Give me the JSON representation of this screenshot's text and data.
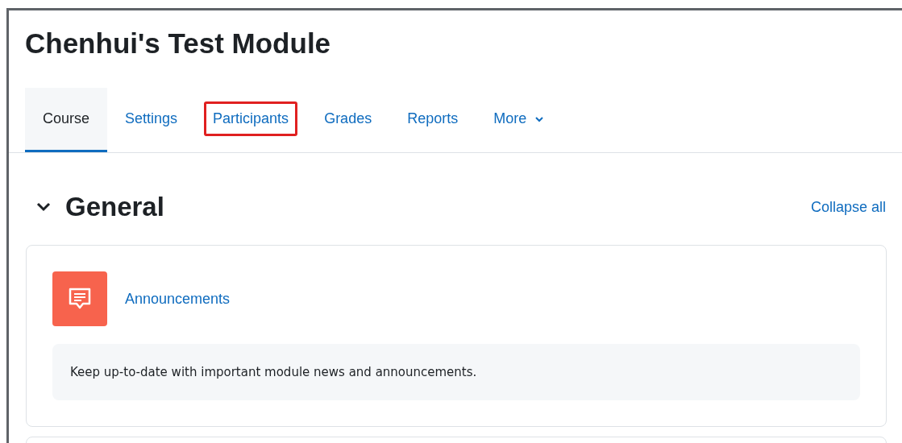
{
  "course_title": "Chenhui's Test Module",
  "tabs": [
    {
      "label": "Course",
      "selected": true,
      "highlighted": false,
      "kind": "plain"
    },
    {
      "label": "Settings",
      "selected": false,
      "highlighted": false,
      "kind": "plain"
    },
    {
      "label": "Participants",
      "selected": false,
      "highlighted": true,
      "kind": "plain"
    },
    {
      "label": "Grades",
      "selected": false,
      "highlighted": false,
      "kind": "plain"
    },
    {
      "label": "Reports",
      "selected": false,
      "highlighted": false,
      "kind": "plain"
    },
    {
      "label": "More",
      "selected": false,
      "highlighted": false,
      "kind": "dropdown"
    }
  ],
  "section": {
    "title": "General",
    "expanded": true,
    "collapse_link": "Collapse all",
    "activities": [
      {
        "name": "Announcements",
        "description": "Keep up-to-date with important module news and announcements."
      }
    ]
  }
}
